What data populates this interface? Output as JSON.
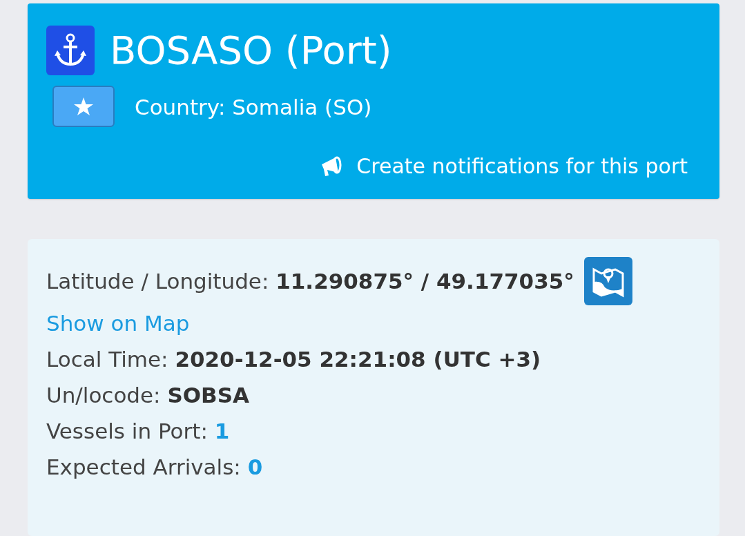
{
  "header": {
    "title": "BOSASO (Port)",
    "country": "Country: Somalia (SO)",
    "notify_link": "Create notifications for this port"
  },
  "info": {
    "coordinates": {
      "label": "Latitude / Longitude:",
      "value": "11.290875° / 49.177035°"
    },
    "map_link": "Show on Map",
    "fields": [
      {
        "label": "Local Time:",
        "value": "2020-12-05 22:21:08 (UTC +3)",
        "kind": "text"
      },
      {
        "label": "Un/locode:",
        "value": "SOBSA",
        "kind": "text"
      },
      {
        "label": "Vessels in Port:",
        "value": "1",
        "kind": "count"
      },
      {
        "label": "Expected Arrivals:",
        "value": "0",
        "kind": "count"
      }
    ]
  }
}
